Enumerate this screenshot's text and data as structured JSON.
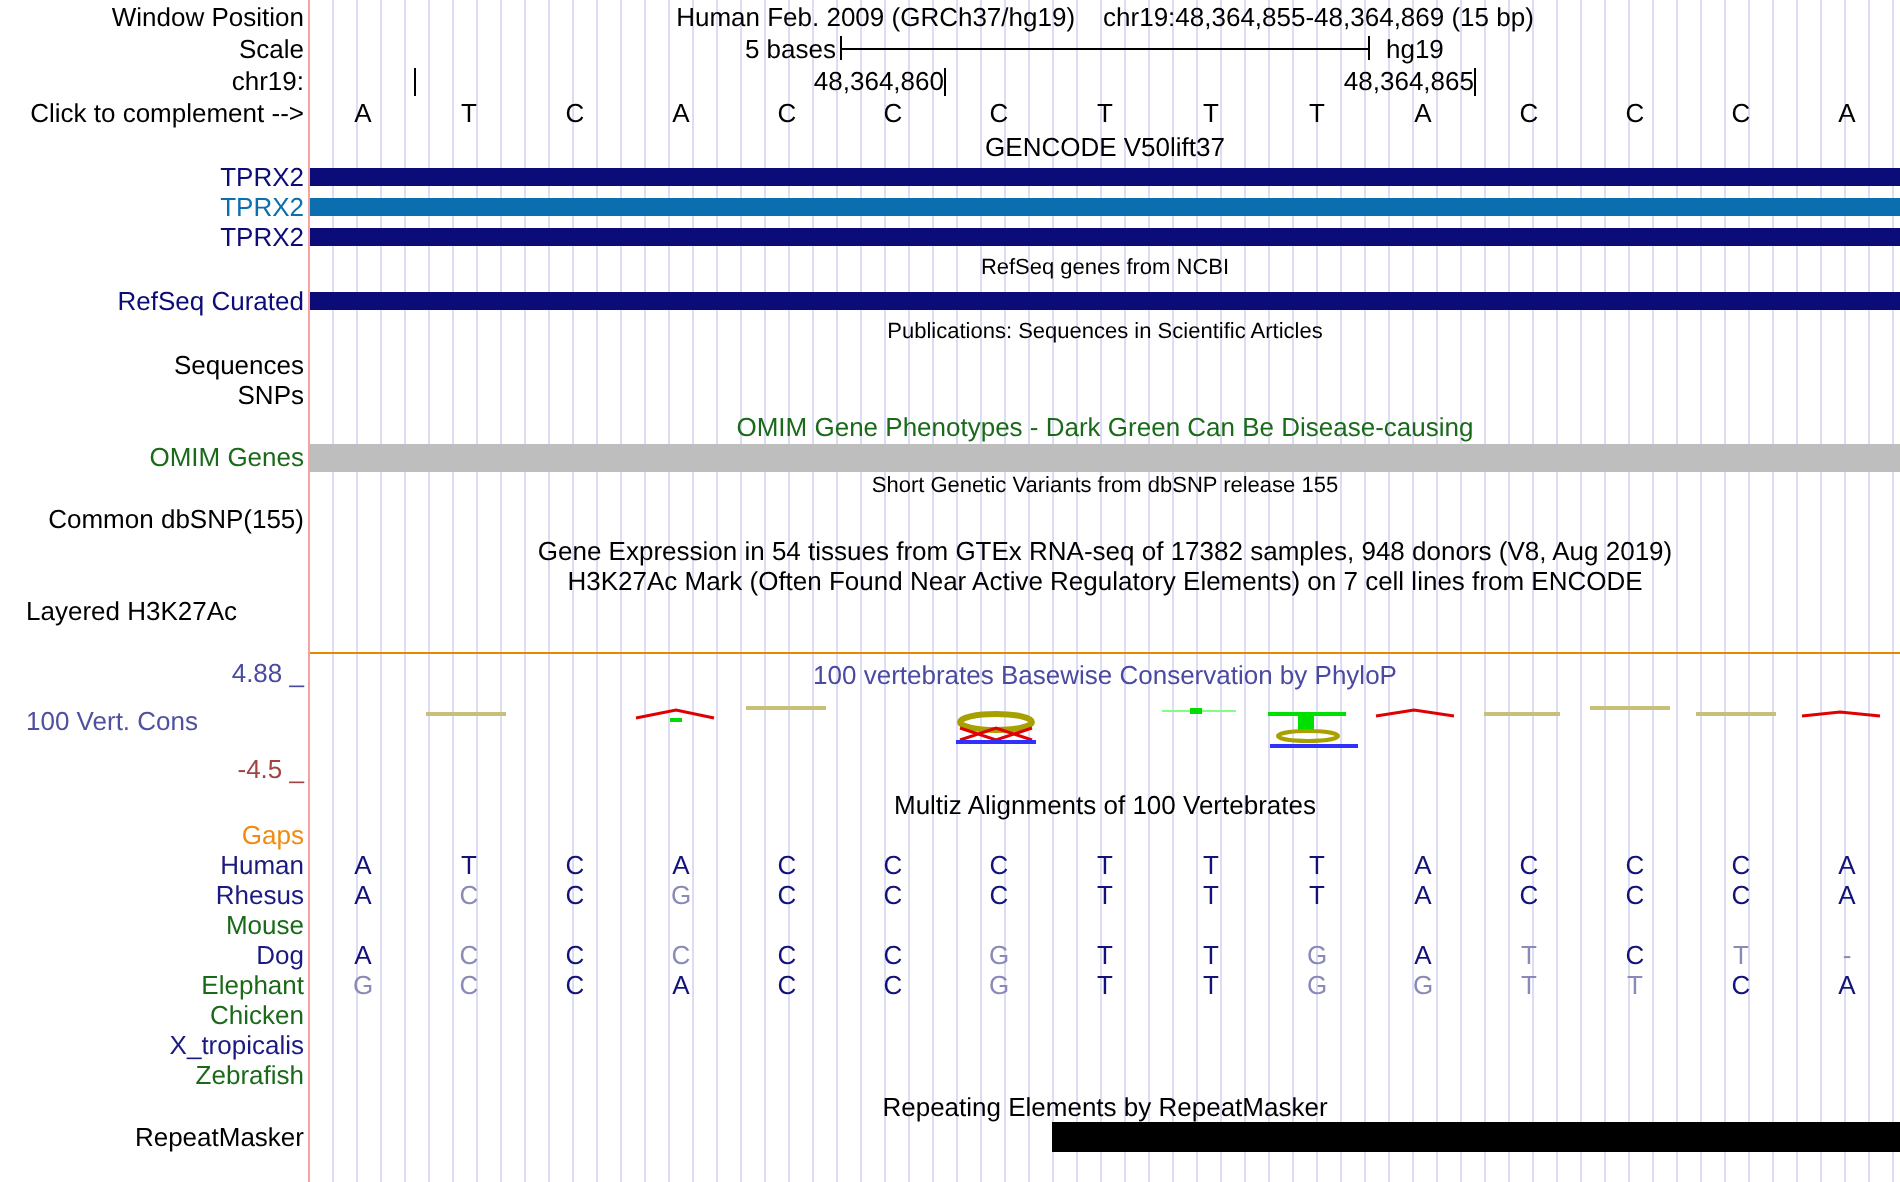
{
  "header": {
    "window_position_label": "Window Position",
    "assembly_title": "Human Feb. 2009 (GRCh37/hg19)",
    "position": "chr19:48,364,855-48,364,869 (15 bp)",
    "scale_label": "Scale",
    "scale_text": "5 bases",
    "scale_assembly": "hg19",
    "chrom_label": "chr19:",
    "ticks": [
      "48,364,860",
      "48,364,865"
    ],
    "complement_label": "Click to complement -->",
    "bases": [
      "A",
      "T",
      "C",
      "A",
      "C",
      "C",
      "C",
      "T",
      "T",
      "T",
      "A",
      "C",
      "C",
      "C",
      "A"
    ]
  },
  "tracks": [
    {
      "kind": "genes",
      "title": "GENCODE V50lift37",
      "items": [
        {
          "label": "TPRX2",
          "color": "#0c0c78"
        },
        {
          "label": "TPRX2",
          "color": "#0b6eae"
        },
        {
          "label": "TPRX2",
          "color": "#0c0c78"
        }
      ]
    },
    {
      "kind": "genes",
      "title": "RefSeq genes from NCBI",
      "small": true,
      "items": [
        {
          "label": "RefSeq Curated",
          "color": "#0c0c78"
        }
      ]
    },
    {
      "kind": "labels",
      "title": "Publications: Sequences in Scientific Articles",
      "small": true,
      "labels": [
        "Sequences",
        "SNPs"
      ]
    },
    {
      "kind": "phenotype",
      "title": "OMIM Gene Phenotypes - Dark Green Can Be Disease-causing",
      "color": "#1a6a1a",
      "label": "OMIM Genes"
    },
    {
      "kind": "labels",
      "title": "Short Genetic Variants from dbSNP release 155",
      "small": true,
      "labels": [
        "Common dbSNP(155)"
      ]
    },
    {
      "kind": "labels",
      "title": "Gene Expression in 54 tissues from GTEx RNA-seq of 17382 samples, 948 donors (V8, Aug 2019)"
    },
    {
      "kind": "layered",
      "title": "H3K27Ac Mark (Often Found Near Active Regulatory Elements) on 7 cell lines from ENCODE",
      "label": "Layered H3K27Ac"
    },
    {
      "kind": "conservation",
      "title": "100 vertebrates Basewise Conservation by PhyloP",
      "label": "100 Vert. Cons",
      "y_max": "4.88 _",
      "y_min": "-4.5 _"
    },
    {
      "kind": "alignment",
      "title": "Multiz Alignments of 100 Vertebrates",
      "gaps_label": "Gaps",
      "species": [
        {
          "name": "Human",
          "color": "#1a1a80",
          "bases": [
            "A",
            "T",
            "C",
            "A",
            "C",
            "C",
            "C",
            "T",
            "T",
            "T",
            "A",
            "C",
            "C",
            "C",
            "A"
          ],
          "differs": [
            false,
            false,
            false,
            false,
            false,
            false,
            false,
            false,
            false,
            false,
            false,
            false,
            false,
            false,
            false
          ]
        },
        {
          "name": "Rhesus",
          "color": "#1a1a80",
          "bases": [
            "A",
            "C",
            "C",
            "G",
            "C",
            "C",
            "C",
            "T",
            "T",
            "T",
            "A",
            "C",
            "C",
            "C",
            "A"
          ],
          "differs": [
            false,
            true,
            false,
            true,
            false,
            false,
            false,
            false,
            false,
            false,
            false,
            false,
            false,
            false,
            false
          ]
        },
        {
          "name": "Mouse",
          "color": "#1a6a1a"
        },
        {
          "name": "Dog",
          "color": "#1a1a80",
          "bases": [
            "A",
            "C",
            "C",
            "C",
            "C",
            "C",
            "G",
            "T",
            "T",
            "G",
            "A",
            "T",
            "C",
            "T",
            "-"
          ],
          "differs": [
            false,
            true,
            false,
            true,
            false,
            false,
            true,
            false,
            false,
            true,
            false,
            true,
            false,
            true,
            true
          ]
        },
        {
          "name": "Elephant",
          "color": "#1a6a1a",
          "bases": [
            "G",
            "C",
            "C",
            "A",
            "C",
            "C",
            "G",
            "T",
            "T",
            "G",
            "G",
            "T",
            "T",
            "C",
            "A"
          ],
          "differs": [
            true,
            true,
            false,
            false,
            false,
            false,
            true,
            false,
            false,
            true,
            true,
            true,
            true,
            false,
            false
          ]
        },
        {
          "name": "Chicken",
          "color": "#1a6a1a"
        },
        {
          "name": "X_tropicalis",
          "color": "#1a1a80"
        },
        {
          "name": "Zebrafish",
          "color": "#1a6a1a"
        }
      ]
    },
    {
      "kind": "repeat",
      "title": "Repeating Elements by RepeatMasker",
      "label": "RepeatMasker",
      "covered": [
        false,
        false,
        false,
        false,
        false,
        false,
        false,
        true,
        true,
        true,
        true,
        true,
        true,
        true,
        true
      ]
    }
  ]
}
